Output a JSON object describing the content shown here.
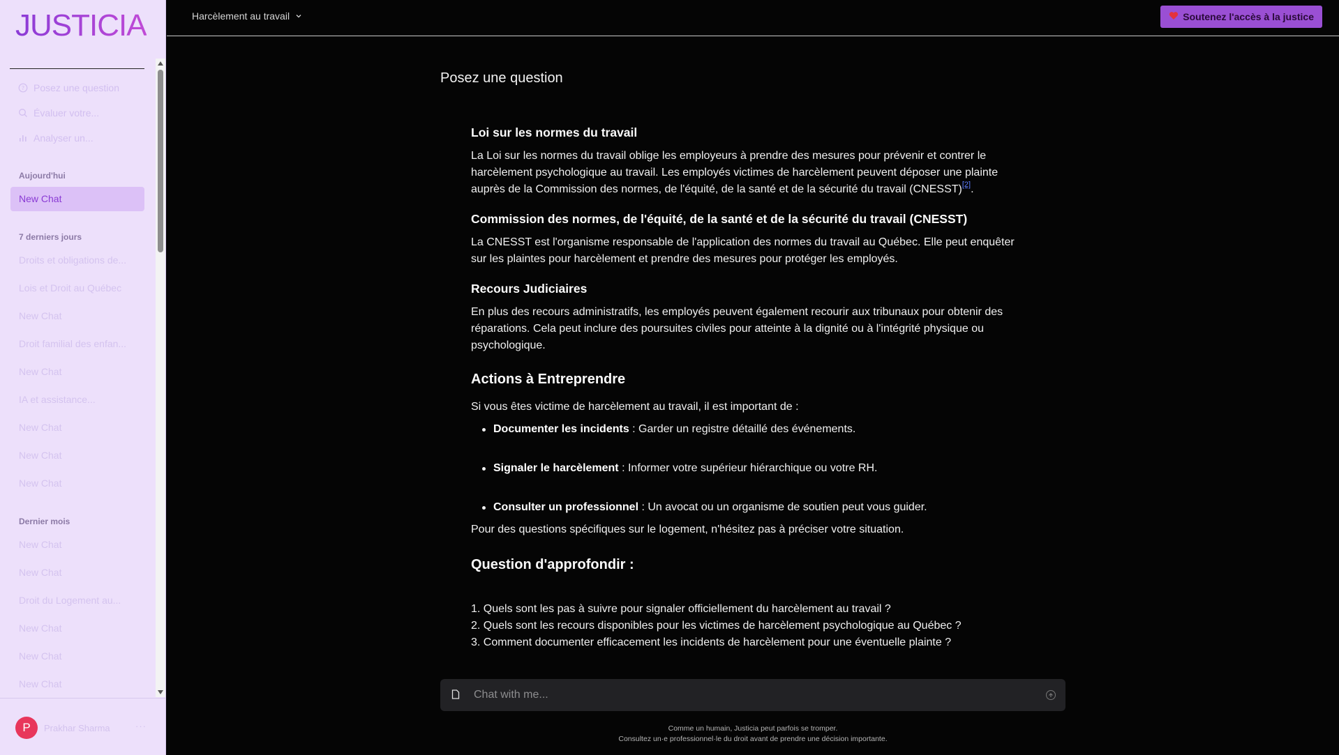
{
  "app": {
    "logo": "JUSTICIA"
  },
  "sidebar": {
    "nav": [
      {
        "label": "Posez une question",
        "icon": "question-circle-icon"
      },
      {
        "label": "Évaluer votre...",
        "icon": "search-icon"
      },
      {
        "label": "Analyser un...",
        "icon": "bar-chart-icon"
      }
    ],
    "groups": {
      "today": {
        "label": "Aujourd'hui",
        "items": [
          "New Chat"
        ]
      },
      "week": {
        "label": "7 derniers jours",
        "items": [
          "Droits et obligations de...",
          "Lois et Droit au Québec",
          "New Chat",
          "Droit familial des enfan...",
          "New Chat",
          "IA et assistance...",
          "New Chat",
          "New Chat",
          "New Chat"
        ]
      },
      "month": {
        "label": "Dernier mois",
        "items": [
          "New Chat",
          "New Chat",
          "Droit du Logement au...",
          "New Chat",
          "New Chat",
          "New Chat"
        ]
      }
    },
    "user": {
      "initial": "P",
      "name": "Prakhar Sharma",
      "more": "···"
    }
  },
  "topbar": {
    "model": "Harcèlement au travail",
    "support_label": "Soutenez l'accès à la justice",
    "support_icon": "heart-icon",
    "support_color": "#9a4fd4"
  },
  "main": {
    "title": "Posez une question",
    "answer": {
      "h1": "Loi sur les normes du travail",
      "p1a": "La Loi sur les normes du travail oblige les employeurs à prendre des mesures pour prévenir et contrer le",
      "p1b": "harcèlement psychologique au travail. Les employés victimes de harcèlement peuvent déposer une plainte",
      "p1c": "auprès de la Commission des normes, de l'équité, de la santé et de la sécurité du travail (CNESST)",
      "p1_ref": "[2]",
      "p1_end": ".",
      "h2": "Commission des normes, de l'équité, de la santé et de la sécurité du travail (CNESST)",
      "p2a": "La CNESST est l'organisme responsable de l'application des normes du travail au Québec. Elle peut enquêter",
      "p2b": "sur les plaintes pour harcèlement et prendre des mesures pour protéger les employés.",
      "h3": "Recours Judiciaires",
      "p3a": "En plus des recours administratifs, les employés peuvent également recourir aux tribunaux pour obtenir des",
      "p3b": "réparations. Cela peut inclure des poursuites civiles pour atteinte à la dignité ou à l'intégrité physique ou",
      "p3c": "psychologique.",
      "h4": "Actions à Entreprendre",
      "p4": "Si vous êtes victime de harcèlement au travail, il est important de :",
      "bullets": [
        {
          "bold": "Documenter les incidents",
          "text": " : Garder un registre détaillé des événements."
        },
        {
          "bold": "Signaler le harcèlement",
          "text": " : Informer votre supérieur hiérarchique ou votre RH."
        },
        {
          "bold": "Consulter un professionnel",
          "text": " : Un avocat ou un organisme de soutien peut vous guider."
        }
      ],
      "p5": "Pour des questions spécifiques sur le logement, n'hésitez pas à préciser votre situation.",
      "h5": "Question d'approfondir :",
      "q1": "1. Quels sont les pas à suivre pour signaler officiellement du harcèlement au travail ?",
      "q2": "2. Quels sont les recours disponibles pour les victimes de harcèlement psychologique au Québec ?",
      "q3": "3. Comment documenter efficacement les incidents de harcèlement pour une éventuelle plainte ?"
    },
    "chat": {
      "placeholder": "Chat with me..."
    },
    "disclaimer": {
      "line1": "Comme un humain, Justicia peut parfois se tromper.",
      "line2": "Consultez un·e professionnel·le du droit avant de prendre une décision importante."
    }
  }
}
